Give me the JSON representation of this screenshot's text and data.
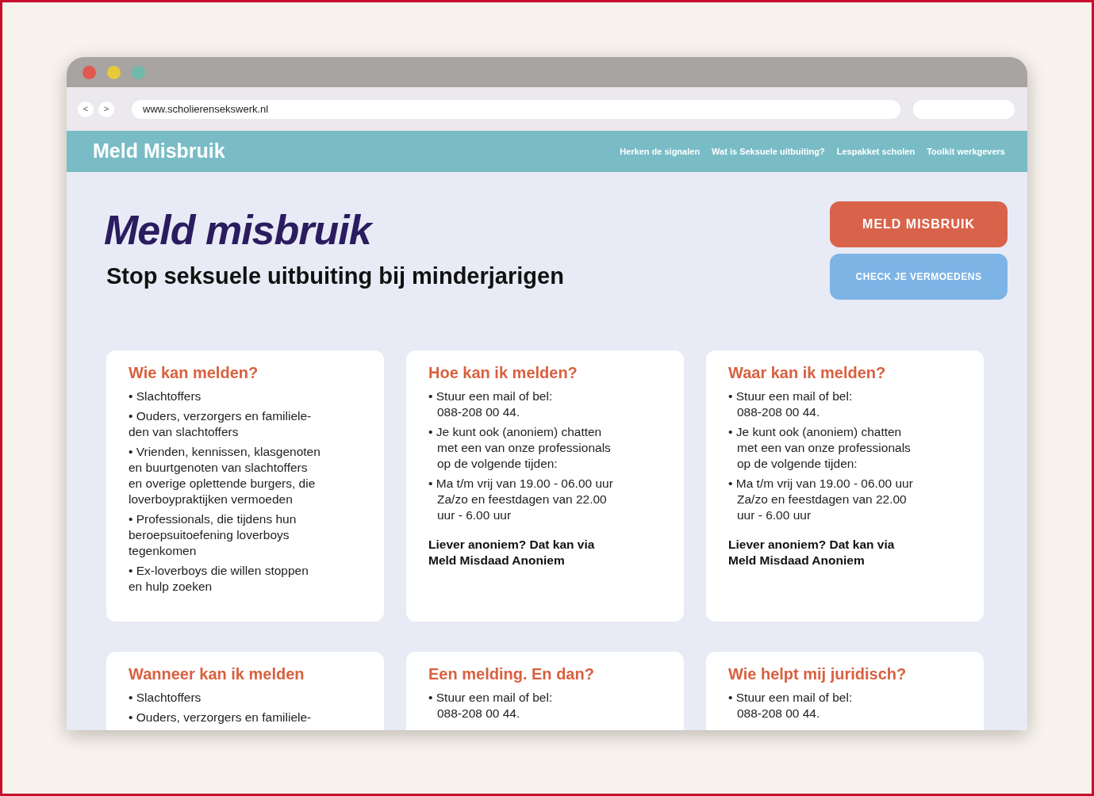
{
  "browser": {
    "back": "<",
    "forward": ">",
    "url": "www.scholierensekswerk.nl"
  },
  "site": {
    "logo": "Meld Misbruik",
    "nav": [
      "Herken de signalen",
      "Wat is Seksuele uitbuiting?",
      "Lespakket scholen",
      "Toolkit werkgevers"
    ]
  },
  "hero": {
    "title": "Meld misbruik",
    "subtitle": "Stop seksuele uitbuiting bij minderjarigen",
    "buttons": [
      {
        "label": "MELD MISBRUIK",
        "kind": "primary"
      },
      {
        "label": "CHECK JE VERMOEDENS",
        "kind": "secondary"
      }
    ]
  },
  "cards": [
    {
      "title": "Wie kan melden?",
      "hanging": false,
      "items": [
        [
          "• Slachtoffers"
        ],
        [
          "• Ouders, verzorgers en familiele-",
          "den van slachtoffers"
        ],
        [
          "• Vrienden, kennissen, klasgenoten",
          "en buurtgenoten van slachtoffers",
          "en overige oplettende burgers, die",
          "loverboypraktijken vermoeden"
        ],
        [
          "• Professionals, die tijdens hun",
          "beroepsuitoefening loverboys",
          "tegenkomen"
        ],
        [
          "• Ex-loverboys die willen stoppen",
          "en hulp zoeken"
        ]
      ]
    },
    {
      "title": "Hoe kan ik melden?",
      "hanging": true,
      "items": [
        [
          "• Stuur een mail of bel:",
          "088-208 00 44."
        ],
        [
          "• Je kunt ook (anoniem) chatten",
          "met een van onze professionals",
          "op de volgende tijden:"
        ],
        [
          "• Ma t/m vrij van 19.00 - 06.00 uur",
          "Za/zo en feestdagen van 22.00",
          "uur - 6.00 uur"
        ]
      ],
      "note": [
        "Liever anoniem? Dat kan via",
        "Meld Misdaad Anoniem"
      ]
    },
    {
      "title": "Waar kan ik melden?",
      "hanging": true,
      "items": [
        [
          "• Stuur een mail of bel:",
          "088-208 00 44."
        ],
        [
          "• Je kunt ook (anoniem) chatten",
          "met een van onze professionals",
          "op de volgende tijden:"
        ],
        [
          "• Ma t/m vrij van 19.00 - 06.00 uur",
          "Za/zo en feestdagen van 22.00",
          "uur - 6.00 uur"
        ]
      ],
      "note": [
        "Liever anoniem? Dat kan via",
        "Meld Misdaad Anoniem"
      ]
    },
    {
      "title": "Wanneer kan ik melden",
      "items": [
        [
          "• Slachtoffers"
        ],
        [
          "• Ouders, verzorgers en familiele-"
        ]
      ]
    },
    {
      "title": "Een melding. En dan?",
      "hanging": true,
      "items": [
        [
          "• Stuur een mail of bel:",
          "088-208 00 44."
        ]
      ]
    },
    {
      "title": "Wie helpt mij juridisch?",
      "hanging": true,
      "items": [
        [
          "• Stuur een mail of bel:",
          "088-208 00 44."
        ]
      ]
    }
  ]
}
